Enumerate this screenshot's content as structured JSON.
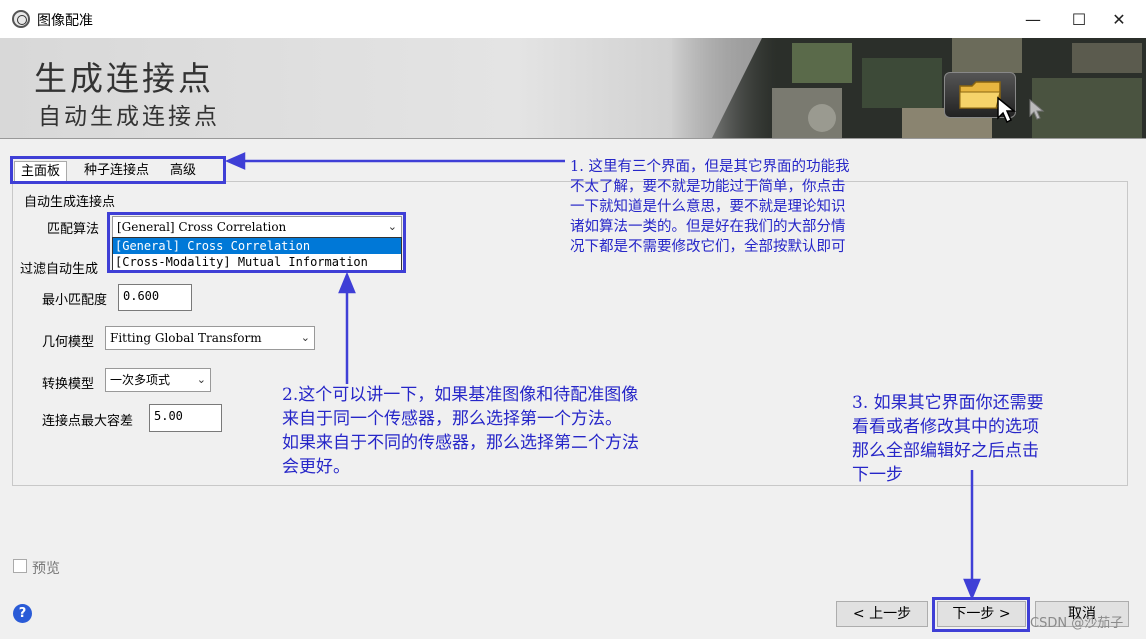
{
  "window": {
    "title": "图像配准",
    "minimize": "—",
    "maximize": "☐",
    "close": "✕"
  },
  "banner": {
    "title": "生成连接点",
    "subtitle": "自动生成连接点"
  },
  "tabs": [
    {
      "label": "主面板",
      "active": true
    },
    {
      "label": "种子连接点",
      "active": false
    },
    {
      "label": "高级",
      "active": false
    }
  ],
  "panel": {
    "group1_title": "自动生成连接点",
    "matching_algorithm_label": "匹配算法",
    "matching_algorithm_value": "[General] Cross Correlation",
    "matching_algorithm_options": [
      "[General] Cross Correlation",
      "[Cross-Modality] Mutual Information"
    ],
    "group2_title": "过滤自动生成",
    "min_match_label": "最小匹配度",
    "min_match_value": "0.600",
    "geometry_model_label": "几何模型",
    "geometry_model_value": "Fitting Global Transform",
    "transform_model_label": "转换模型",
    "transform_model_value": "一次多项式",
    "max_tolerance_label": "连接点最大容差",
    "max_tolerance_value": "5.00"
  },
  "annotations": {
    "note1": "1. 这里有三个界面，但是其它界面的功能我\n不太了解，要不就是功能过于简单，你点击\n一下就知道是什么意思，要不就是理论知识\n诸如算法一类的。但是好在我们的大部分情\n况下都是不需要修改它们，全部按默认即可",
    "note2": "2.这个可以讲一下，如果基准图像和待配准图像\n来自于同一个传感器，那么选择第一个方法。\n如果来自于不同的传感器，那么选择第二个方法\n会更好。",
    "note3": "3. 如果其它界面你还需要\n看看或者修改其中的选项\n那么全部编辑好之后点击\n下一步"
  },
  "footer": {
    "preview_label": "预览",
    "help": "?",
    "back_button": "< 上一步",
    "next_button": "下一步 >",
    "cancel_button": "取消"
  },
  "watermark": "CSDN @沙茄子",
  "colors": {
    "annotation": "#3f3fd6",
    "selection": "#0078d7"
  }
}
